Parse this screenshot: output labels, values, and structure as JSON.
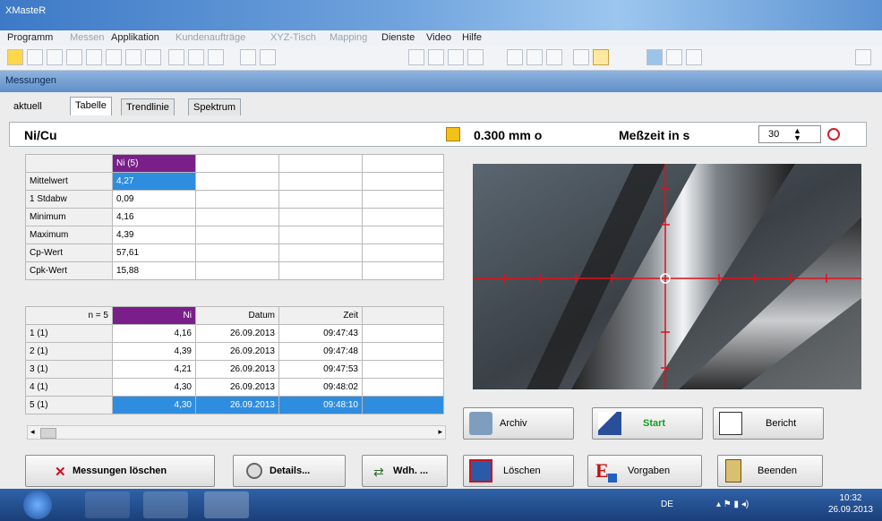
{
  "window": {
    "title": "XMasteR"
  },
  "menu": [
    {
      "label": "Programm",
      "disabled": false
    },
    {
      "label": "Messen",
      "disabled": true
    },
    {
      "label": "Applikation",
      "disabled": false
    },
    {
      "label": "Kundenaufträge",
      "disabled": true
    },
    {
      "label": "XYZ-Tisch",
      "disabled": true
    },
    {
      "label": "Mapping",
      "disabled": true
    },
    {
      "label": "Dienste",
      "disabled": false
    },
    {
      "label": "Video",
      "disabled": false
    },
    {
      "label": "Hilfe",
      "disabled": false
    }
  ],
  "subwindow": {
    "title": "Messungen"
  },
  "tabs": {
    "current": "aktuell",
    "table": "Tabelle",
    "trend": "Trendlinie",
    "spectrum": "Spektrum"
  },
  "header": {
    "product": "Ni/Cu",
    "collimator": "0.300 mm o",
    "time_label": "Meßzeit in s",
    "time_value": "30"
  },
  "stats": {
    "column": "Ni (5)",
    "rows": [
      {
        "label": "Mittelwert",
        "value": "4,27"
      },
      {
        "label": "1 Stdabw",
        "value": "0,09"
      },
      {
        "label": "Minimum",
        "value": "4,16"
      },
      {
        "label": "Maximum",
        "value": "4,39"
      },
      {
        "label": "Cp-Wert",
        "value": "57,61"
      },
      {
        "label": "Cpk-Wert",
        "value": "15,88"
      }
    ]
  },
  "measurements": {
    "headers": {
      "n": "n = 5",
      "ni": "Ni",
      "date": "Datum",
      "time": "Zeit"
    },
    "rows": [
      {
        "n": "1  (1)",
        "ni": "4,16",
        "date": "26.09.2013",
        "time": "09:47:43"
      },
      {
        "n": "2  (1)",
        "ni": "4,39",
        "date": "26.09.2013",
        "time": "09:47:48"
      },
      {
        "n": "3  (1)",
        "ni": "4,21",
        "date": "26.09.2013",
        "time": "09:47:53"
      },
      {
        "n": "4  (1)",
        "ni": "4,30",
        "date": "26.09.2013",
        "time": "09:48:02"
      },
      {
        "n": "5  (1)",
        "ni": "4,30",
        "date": "26.09.2013",
        "time": "09:48:10"
      }
    ]
  },
  "buttons": {
    "archive": "Archiv",
    "start": "Start",
    "report": "Bericht",
    "delete_measurements": "Messungen löschen",
    "details": "Details...",
    "repeat": "Wdh. ...",
    "delete": "Löschen",
    "defaults": "Vorgaben",
    "exit": "Beenden"
  },
  "taskbar": {
    "lang": "DE",
    "time": "10:32",
    "date": "26.09.2013"
  },
  "colors": {
    "accent_purple": "#7a1f8a",
    "selection_blue": "#2f8de0",
    "crosshair_red": "#e0101a"
  }
}
